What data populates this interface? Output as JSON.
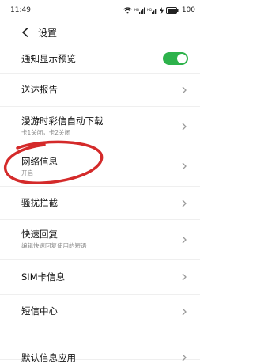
{
  "status_bar": {
    "time": "11:49",
    "battery": "100"
  },
  "header": {
    "title": "设置"
  },
  "settings": {
    "items": [
      {
        "title": "通知显示预览",
        "subtitle": "",
        "control": "toggle",
        "toggle_on": true
      },
      {
        "title": "送达报告",
        "subtitle": "",
        "control": "chevron"
      },
      {
        "title": "漫游时彩信自动下载",
        "subtitle": "卡1关闭，卡2关闭",
        "control": "chevron"
      },
      {
        "title": "网络信息",
        "subtitle": "开启",
        "control": "chevron"
      },
      {
        "title": "骚扰拦截",
        "subtitle": "",
        "control": "chevron"
      },
      {
        "title": "快速回复",
        "subtitle": "编辑快速回复使用的短语",
        "control": "chevron"
      },
      {
        "title": "SIM卡信息",
        "subtitle": "",
        "control": "chevron"
      },
      {
        "title": "短信中心",
        "subtitle": "",
        "control": "chevron"
      },
      {
        "title": "默认信息应用",
        "subtitle": "",
        "control": "chevron"
      }
    ]
  },
  "colors": {
    "toggle_on": "#2db24b",
    "annotation": "#d42a2a"
  }
}
